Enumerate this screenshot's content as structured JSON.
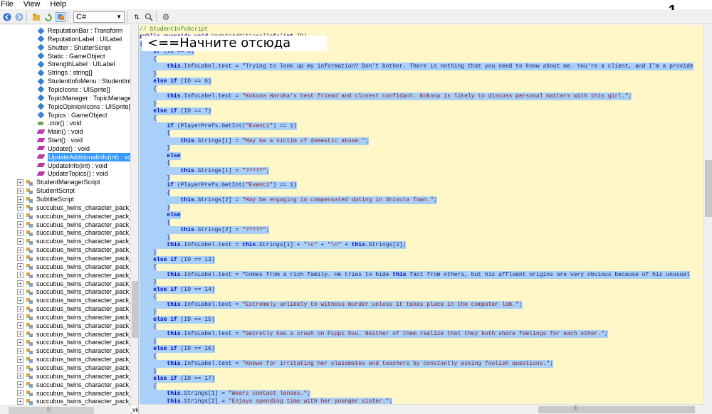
{
  "menu": [
    "File",
    "View",
    "Help"
  ],
  "page_number": "1",
  "toolbar": {
    "language": "C#",
    "icons": [
      "back-icon",
      "forward-icon",
      "open-icon",
      "refresh-icon",
      "browse-icon",
      "sort-icon",
      "search-icon",
      "settings-icon"
    ]
  },
  "tree": {
    "members": [
      {
        "label": "ReputationBar : Transform",
        "icon": "field-icon"
      },
      {
        "label": "ReputationLabel : UILabel",
        "icon": "field-icon"
      },
      {
        "label": "Shutter : ShutterScript",
        "icon": "field-icon"
      },
      {
        "label": "Static : GameObject",
        "icon": "field-icon"
      },
      {
        "label": "StrengthLabel : UILabel",
        "icon": "field-icon"
      },
      {
        "label": "Strings : string[]",
        "icon": "field-icon"
      },
      {
        "label": "StudentInfoMenu : StudentInfol",
        "icon": "field-icon"
      },
      {
        "label": "TopicIcons : UISprite[]",
        "icon": "field-icon"
      },
      {
        "label": "TopicManager : TopicManagerS",
        "icon": "field-icon"
      },
      {
        "label": "TopicOpinionIcons : UISprite[]",
        "icon": "field-icon"
      },
      {
        "label": "Topics : GameObject",
        "icon": "field-icon"
      },
      {
        "label": ".ctor() : void",
        "icon": "constructor-icon"
      },
      {
        "label": "Main() : void",
        "icon": "method-icon"
      },
      {
        "label": "Start() : void",
        "icon": "method-icon"
      },
      {
        "label": "Update() : void",
        "icon": "method-icon"
      },
      {
        "label": "UpdateAdditionalInfo(int) : void",
        "icon": "method-icon",
        "selected": true
      },
      {
        "label": "UpdateInfo(int) : void",
        "icon": "method-icon"
      },
      {
        "label": "UpdateTopics() : void",
        "icon": "method-icon"
      }
    ],
    "classes": [
      "StudentManagerScript",
      "StudentScript",
      "SubtitleScript",
      "succubus_twins_character_pack_ma",
      "succubus_twins_character_pack_my",
      "succubus_twins_character_pack_rig",
      "succubus_twins_character_pack_sce",
      "succubus_twins_character_pack_sec",
      "succubus_twins_character_pack_suc",
      "succubus_twins_character_pack_suc",
      "succubus_twins_character_pack_suc",
      "succubus_twins_character_pack_suc",
      "succubus_twins_character_pack_suc",
      "succubus_twins_character_pack_suc",
      "succubus_twins_character_pack_suc",
      "succubus_twins_character_pack_suc",
      "succubus_twins_character_pack_suc",
      "succubus_twins_character_pack_suc",
      "succubus_twins_character_pack_vie",
      "succubus_twins_character_pack_vie",
      "succubus_twins_character_pack_vie",
      "succubus_twins_character_pack_vie",
      "succubus_twins_character_pack_vie",
      "succubus_twins_character_pack_vie",
      "succubus_twins_character_pack_vie",
      "succubus_twins_character_pack_vie",
      "succubus_twins_character_pack_vie",
      "succubus_twins_character_pack_vie"
    ]
  },
  "callout": "<==Начните отсюда",
  "code": [
    {
      "text": "// StudentInfoScript",
      "comment": true
    },
    {
      "text": "public override void UpdateAdditionalInfo(int ID)",
      "sel": false
    },
    {
      "text": "{",
      "sel": true
    },
    {
      "text": "    if (ID == 0)",
      "sel": true
    },
    {
      "text": "    {",
      "sel": true
    },
    {
      "text": "        this.InfoLabel.text = \"Trying to look up my information? Don't bother. There is nothing that you need to know about me. You're a client, and I'm a provide",
      "sel": true
    },
    {
      "text": "    }",
      "sel": true
    },
    {
      "text": "    else if (ID == 6)",
      "sel": true
    },
    {
      "text": "    {",
      "sel": true
    },
    {
      "text": "        this.InfoLabel.text = \"Kokona Haruka's best friend and closest confidant. Kokona is likely to discuss personal matters with this girl.\";",
      "sel": true
    },
    {
      "text": "    }",
      "sel": true
    },
    {
      "text": "    else if (ID == 7)",
      "sel": true
    },
    {
      "text": "    {",
      "sel": true
    },
    {
      "text": "        if (PlayerPrefs.GetInt(\"Event1\") == 1)",
      "sel": true
    },
    {
      "text": "        {",
      "sel": true
    },
    {
      "text": "            this.Strings[1] = \"May be a victim of domestic abuse.\";",
      "sel": true
    },
    {
      "text": "        }",
      "sel": true
    },
    {
      "text": "        else",
      "sel": true
    },
    {
      "text": "        {",
      "sel": true
    },
    {
      "text": "            this.Strings[1] = \"?????\";",
      "sel": true
    },
    {
      "text": "        }",
      "sel": true
    },
    {
      "text": "        if (PlayerPrefs.GetInt(\"Event2\") == 1)",
      "sel": true
    },
    {
      "text": "        {",
      "sel": true
    },
    {
      "text": "            this.Strings[2] = \"May be engaging in compensated dating in Shisuta Town.\";",
      "sel": true
    },
    {
      "text": "        }",
      "sel": true
    },
    {
      "text": "        else",
      "sel": true
    },
    {
      "text": "        {",
      "sel": true
    },
    {
      "text": "            this.Strings[2] = \"?????\";",
      "sel": true
    },
    {
      "text": "        }",
      "sel": true
    },
    {
      "text": "        this.InfoLabel.text = this.Strings[1] + \"\\n\" + \"\\n\" + this.Strings[2];",
      "sel": true
    },
    {
      "text": "    }",
      "sel": true
    },
    {
      "text": "    else if (ID == 13)",
      "sel": true
    },
    {
      "text": "    {",
      "sel": true
    },
    {
      "text": "        this.InfoLabel.text = \"Comes from a rich family. He tries to hide this fact from others, but his affluent origins are very obvious because of his unusual",
      "sel": true
    },
    {
      "text": "    }",
      "sel": true
    },
    {
      "text": "    else if (ID == 14)",
      "sel": true
    },
    {
      "text": "    {",
      "sel": true
    },
    {
      "text": "        this.InfoLabel.text = \"Extremely unlikely to witness murder unless it takes place in the computer lab.\";",
      "sel": true
    },
    {
      "text": "    }",
      "sel": true
    },
    {
      "text": "    else if (ID == 15)",
      "sel": true
    },
    {
      "text": "    {",
      "sel": true
    },
    {
      "text": "        this.InfoLabel.text = \"Secretly has a crush on Pippi Osu. Neither of them realize that they both share feelings for each other.\";",
      "sel": true
    },
    {
      "text": "    }",
      "sel": true
    },
    {
      "text": "    else if (ID == 16)",
      "sel": true
    },
    {
      "text": "    {",
      "sel": true
    },
    {
      "text": "        this.InfoLabel.text = \"Known for irritating her classmates and teachers by constantly asking foolish questions.\";",
      "sel": true
    },
    {
      "text": "    }",
      "sel": true
    },
    {
      "text": "    else if (ID == 17)",
      "sel": true
    },
    {
      "text": "    {",
      "sel": true
    },
    {
      "text": "        this.Strings[1] = \"Wears contact lenses.\";",
      "sel": true
    },
    {
      "text": "        this.Strings[2] = \"Enjoys spending time with her younger sister.\";",
      "sel": true
    }
  ]
}
